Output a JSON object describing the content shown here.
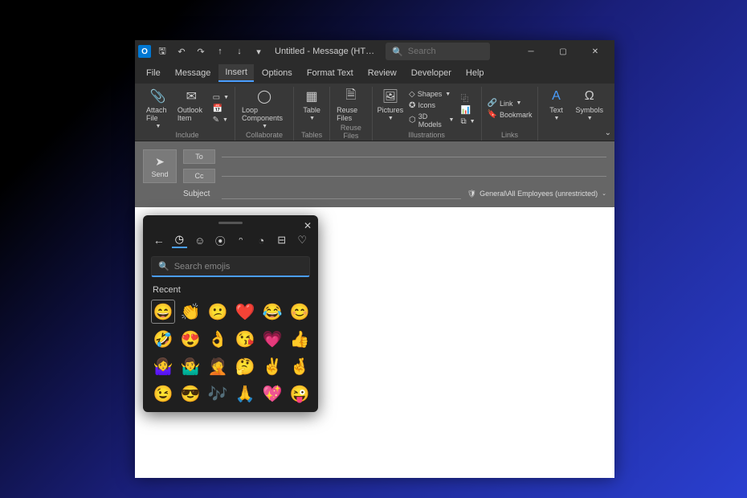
{
  "titlebar": {
    "app_initial": "O",
    "title": "Untitled - Message (HT…",
    "search_placeholder": "Search"
  },
  "menu": {
    "items": [
      "File",
      "Message",
      "Insert",
      "Options",
      "Format Text",
      "Review",
      "Developer",
      "Help"
    ],
    "active_index": 2
  },
  "ribbon": {
    "include": {
      "attach_file": "Attach File",
      "outlook_item": "Outlook Item",
      "label": "Include"
    },
    "collaborate": {
      "loop_components": "Loop Components",
      "label": "Collaborate"
    },
    "tables": {
      "table": "Table",
      "label": "Tables"
    },
    "reuse": {
      "reuse_files": "Reuse Files",
      "label": "Reuse Files"
    },
    "illustrations": {
      "pictures": "Pictures",
      "shapes": "Shapes",
      "icons": "Icons",
      "models": "3D Models",
      "label": "Illustrations"
    },
    "links": {
      "link": "Link",
      "bookmark": "Bookmark",
      "label": "Links"
    },
    "text": {
      "text": "Text",
      "label": ""
    },
    "symbols": {
      "symbols": "Symbols",
      "label": ""
    }
  },
  "compose": {
    "send": "Send",
    "to": "To",
    "cc": "Cc",
    "subject": "Subject",
    "sensitivity": "General\\All Employees (unrestricted)"
  },
  "emoji": {
    "search_placeholder": "Search emojis",
    "section": "Recent",
    "tabs": [
      "back",
      "recent",
      "smileys",
      "gif",
      "kaomoji",
      "food",
      "symbols2",
      "heart"
    ],
    "grid": [
      "😄",
      "👏",
      "😕",
      "❤️",
      "😂",
      "😊",
      "🤣",
      "😍",
      "👌",
      "😘",
      "💗",
      "👍",
      "🤷‍♀️",
      "🤷‍♂️",
      "🤦",
      "🤔",
      "✌️",
      "🤞",
      "😉",
      "😎",
      "🎶",
      "🙏",
      "💖",
      "😜"
    ]
  }
}
